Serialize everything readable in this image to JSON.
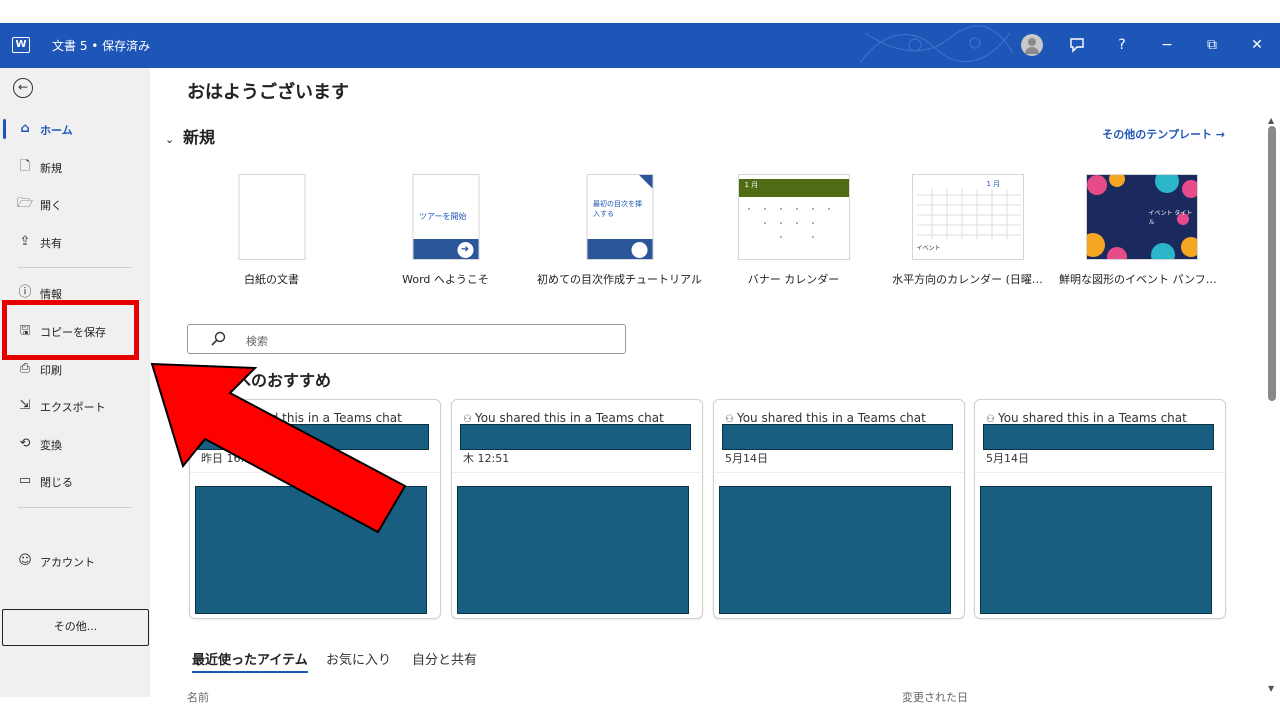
{
  "titlebar": {
    "app_icon": "word-icon",
    "app_icon_letter": "W",
    "doc_title": "文書 5 • 保存済み",
    "buttons": {
      "feedback": "feedback-icon",
      "help": "?",
      "minimize": "−",
      "restore": "⧉",
      "close": "✕"
    }
  },
  "sidebar": {
    "back_glyph": "←",
    "items": [
      {
        "label": "ホーム",
        "icon": "home-icon",
        "glyph": "⌂",
        "active": true
      },
      {
        "label": "新規",
        "icon": "new-document-icon",
        "glyph": "🗋"
      },
      {
        "label": "開く",
        "icon": "open-folder-icon",
        "glyph": "🗁"
      },
      {
        "label": "共有",
        "icon": "share-icon",
        "glyph": "⇪"
      },
      {
        "label": "情報",
        "icon": "info-icon",
        "glyph": "ⓘ"
      },
      {
        "label": "コピーを保存",
        "icon": "save-copy-icon",
        "glyph": "🖫"
      },
      {
        "label": "印刷",
        "icon": "print-icon",
        "glyph": "⎙"
      },
      {
        "label": "エクスポート",
        "icon": "export-icon",
        "glyph": "⇲"
      },
      {
        "label": "変換",
        "icon": "transform-icon",
        "glyph": "⟲"
      },
      {
        "label": "閉じる",
        "icon": "close-folder-icon",
        "glyph": "▭"
      },
      {
        "label": "アカウント",
        "icon": "account-icon",
        "glyph": "☺"
      }
    ],
    "more_label": "その他..."
  },
  "main": {
    "greeting": "おはようございます",
    "new_section": {
      "chevron": "⌄",
      "title": "新規",
      "more_templates": "その他のテンプレート →"
    },
    "templates": [
      {
        "name": "白紙の文書"
      },
      {
        "name": "Word へようこそ",
        "thumb_text": "ツアーを開始"
      },
      {
        "name": "初めての目次作成チュートリアル",
        "thumb_text": "最初の目次を挿入する"
      },
      {
        "name": "バナー カレンダー",
        "thumb_text": "1 月"
      },
      {
        "name": "水平方向のカレンダー (日曜…",
        "thumb_text": "1 月",
        "thumb_text2": "イベント"
      },
      {
        "name": "鮮明な図形のイベント パンフレ…",
        "thumb_text": "イベント タイトル"
      }
    ],
    "search": {
      "placeholder": "検索",
      "icon": "search-icon"
    },
    "recommended": {
      "title": "あなたへのおすすめ",
      "cards": [
        {
          "shared_text": "You shared this in a Teams chat",
          "date": "昨日 16:5"
        },
        {
          "shared_text": "You shared this in a Teams chat",
          "date": "木 12:51"
        },
        {
          "shared_text": "You shared this in a Teams chat",
          "date": "5月14日"
        },
        {
          "shared_text": "You shared this in a Teams chat",
          "date": "5月14日"
        }
      ]
    },
    "tabs": [
      {
        "label": "最近使ったアイテム",
        "active": true
      },
      {
        "label": "お気に入り"
      },
      {
        "label": "自分と共有"
      }
    ],
    "columns": {
      "name": "名前",
      "modified": "変更された日"
    }
  },
  "annotation": {
    "highlight_color": "#e60000",
    "arrow_color": "#ff0000",
    "highlight_target": "コピーを保存"
  },
  "colors": {
    "accent": "#1e56b8",
    "redaction": "#175e80",
    "sidebar_bg": "#f0f0f0"
  }
}
